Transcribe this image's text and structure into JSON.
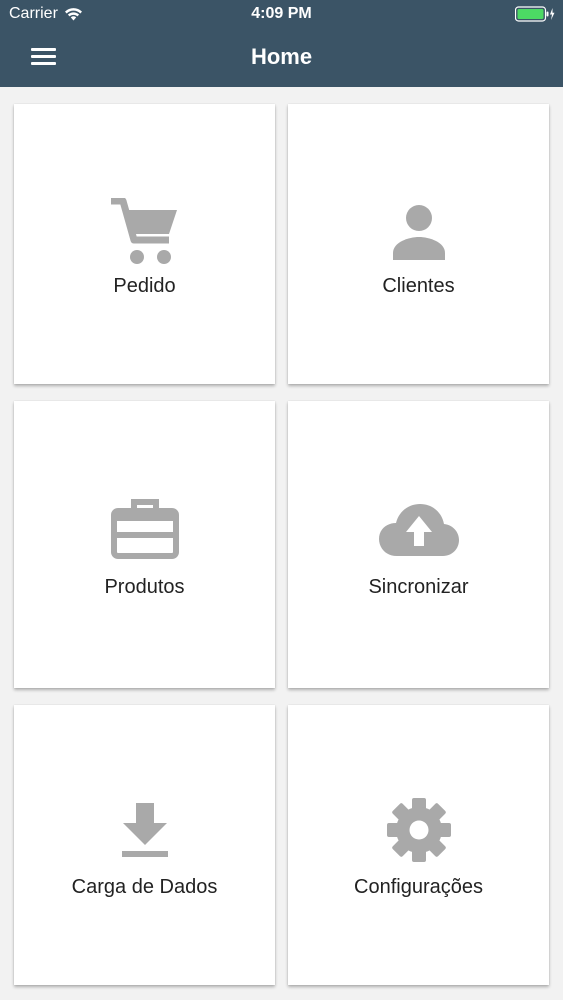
{
  "status_bar": {
    "carrier": "Carrier",
    "time": "4:09 PM",
    "wifi_icon": "wifi-icon",
    "battery_icon": "battery-charging-icon"
  },
  "app_bar": {
    "title": "Home",
    "menu_icon": "hamburger-menu-icon"
  },
  "tiles": [
    {
      "label": "Pedido",
      "icon": "shopping-cart-icon"
    },
    {
      "label": "Clientes",
      "icon": "person-icon"
    },
    {
      "label": "Produtos",
      "icon": "briefcase-icon"
    },
    {
      "label": "Sincronizar",
      "icon": "cloud-upload-icon"
    },
    {
      "label": "Carga de Dados",
      "icon": "download-icon"
    },
    {
      "label": "Configurações",
      "icon": "gear-icon"
    }
  ],
  "colors": {
    "header_bg": "#3b5466",
    "icon_gray": "#a9a9a9",
    "battery_green": "#4cd964"
  }
}
